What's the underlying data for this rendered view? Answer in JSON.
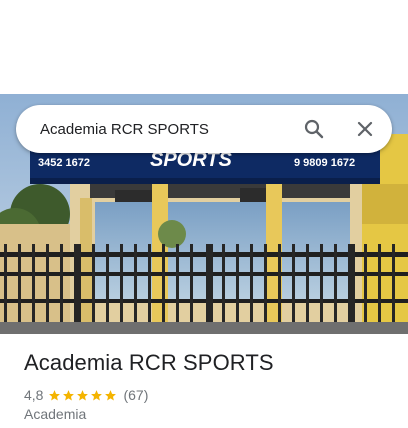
{
  "search": {
    "value": "Academia RCR SPORTS",
    "search_icon": "search-icon",
    "clear_icon": "close-icon"
  },
  "photo": {
    "sign_phone_left": "3452 1672",
    "sign_brand": "SPORTS",
    "sign_phone_right": "9 9809 1672"
  },
  "place": {
    "name": "Academia RCR SPORTS",
    "rating": "4,8",
    "stars_filled": 5,
    "reviews": "(67)",
    "category": "Academia"
  },
  "colors": {
    "star": "#f4b400",
    "sign_blue": "#0e2a63",
    "text_primary": "#202124",
    "text_secondary": "#70757a",
    "icon": "#5f6368"
  }
}
